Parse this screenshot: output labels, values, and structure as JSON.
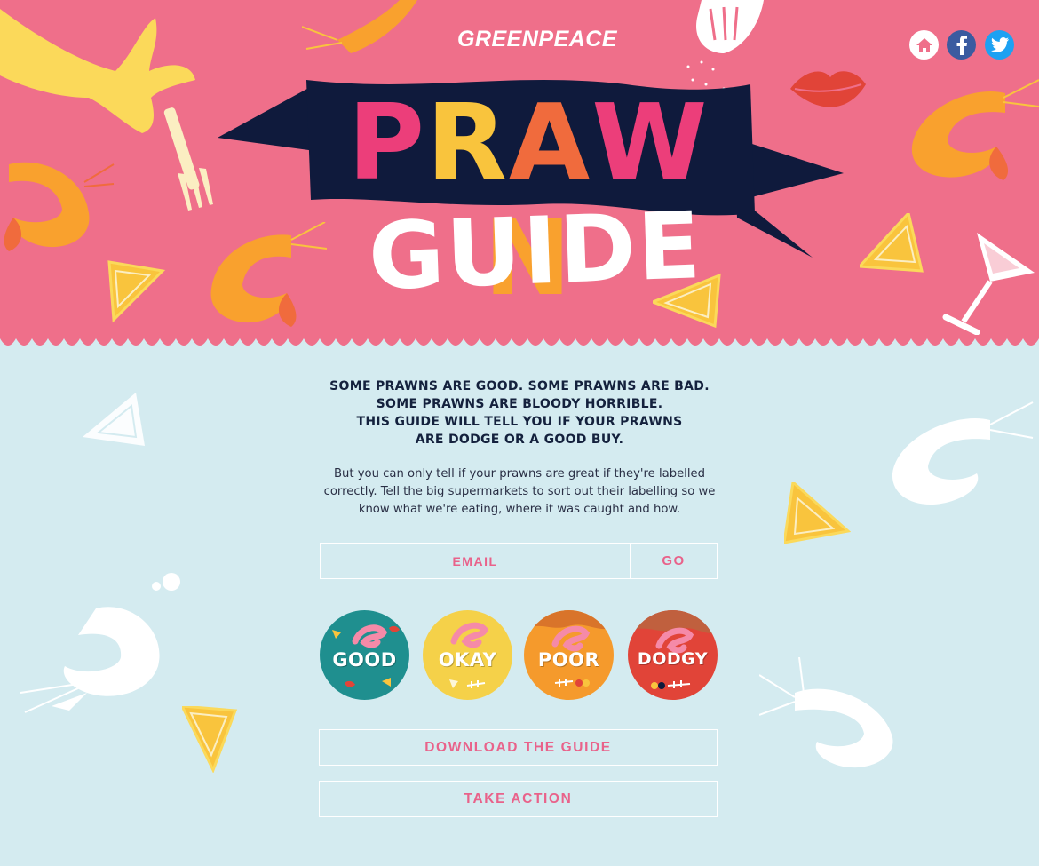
{
  "brand": {
    "name": "GREENPEACE"
  },
  "social": [
    {
      "name": "home",
      "icon": "home-icon"
    },
    {
      "name": "facebook",
      "icon": "facebook-icon"
    },
    {
      "name": "twitter",
      "icon": "twitter-icon"
    }
  ],
  "hero": {
    "title_top": [
      "P",
      "R",
      "A",
      "W",
      "N"
    ],
    "title_top_colors": [
      "#ec3e7a",
      "#f9c43d",
      "#f06b3d",
      "#ec3e7a",
      "#f9a12e"
    ],
    "title_bottom": "GUIDE",
    "background_color": "#ef6f8a",
    "banner_color": "#0f1a3c"
  },
  "intro": {
    "headline": [
      "SOME PRAWNS ARE GOOD. SOME PRAWNS ARE BAD.",
      "SOME PRAWNS ARE BLOODY HORRIBLE.",
      "THIS GUIDE WILL TELL YOU IF YOUR PRAWNS",
      "ARE DODGE OR A GOOD BUY."
    ],
    "body": "But you can only tell if your prawns are great if they're labelled correctly. Tell the big supermarkets to sort out their labelling so we know what we're eating, where it was caught and how."
  },
  "email_form": {
    "placeholder": "EMAIL",
    "submit_label": "GO"
  },
  "ratings": [
    {
      "label": "GOOD",
      "color": "#1f8f8f"
    },
    {
      "label": "OKAY",
      "color": "#f5d149"
    },
    {
      "label": "POOR",
      "color": "#f59a2c"
    },
    {
      "label": "DODGY",
      "color": "#e14438"
    }
  ],
  "actions": {
    "download_label": "DOWNLOAD THE GUIDE",
    "take_action_label": "TAKE ACTION"
  },
  "colors": {
    "accent": "#e9628a",
    "page_background": "#d4ebf0",
    "text_dark": "#14213d"
  }
}
